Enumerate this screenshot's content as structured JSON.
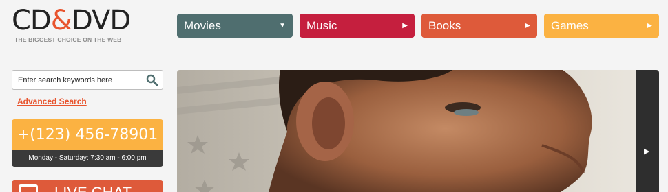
{
  "logo": {
    "cd": "CD",
    "amp": "&",
    "dvd": "DVD",
    "tagline": "THE BIGGEST CHOICE ON THE WEB"
  },
  "nav": [
    {
      "label": "Movies",
      "arrow": "▼",
      "color": "#4f6e6f"
    },
    {
      "label": "Music",
      "arrow": "▶",
      "color": "#c51f3e"
    },
    {
      "label": "Books",
      "arrow": "▶",
      "color": "#de5a3a"
    },
    {
      "label": "Games",
      "arrow": "▶",
      "color": "#fbb242"
    }
  ],
  "search": {
    "placeholder": "Enter search keywords here",
    "icon": "search-icon"
  },
  "advanced_search": "Advanced Search",
  "contact": {
    "phone": "+(123) 456-78901",
    "hours": "Monday - Saturday: 7:30 am - 6:00 pm"
  },
  "chat": {
    "label": "LIVE CHAT",
    "icon": "chat-icon"
  },
  "banner": {
    "next_icon": "chevron-right-icon",
    "next_glyph": "▶"
  }
}
